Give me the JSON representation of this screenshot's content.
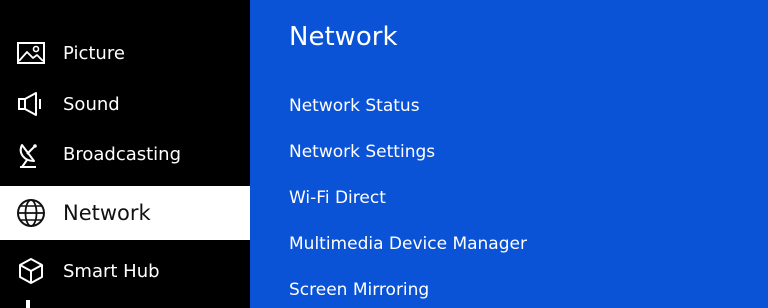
{
  "sidebar": {
    "items": [
      {
        "label": "Picture",
        "icon": "picture-icon",
        "selected": false
      },
      {
        "label": "Sound",
        "icon": "speaker-icon",
        "selected": false
      },
      {
        "label": "Broadcasting",
        "icon": "satellite-dish-icon",
        "selected": false
      },
      {
        "label": "Network",
        "icon": "globe-icon",
        "selected": true
      },
      {
        "label": "Smart Hub",
        "icon": "cube-icon",
        "selected": false
      }
    ]
  },
  "content": {
    "title": "Network",
    "items": [
      {
        "label": "Network Status"
      },
      {
        "label": "Network Settings"
      },
      {
        "label": "Wi-Fi Direct"
      },
      {
        "label": "Multimedia Device Manager"
      },
      {
        "label": "Screen Mirroring"
      }
    ]
  },
  "colors": {
    "sidebar_bg": "#000000",
    "content_bg": "#0a52d6",
    "selected_bg": "#ffffff",
    "text": "#ffffff",
    "selected_text": "#111111"
  }
}
